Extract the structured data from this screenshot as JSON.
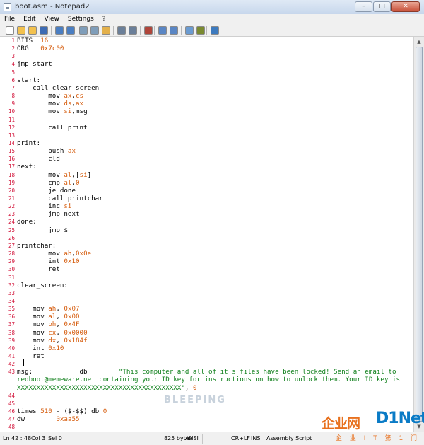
{
  "window": {
    "title": "boot.asm - Notepad2",
    "min_symbol": "–",
    "max_symbol": "□",
    "close_symbol": "✕"
  },
  "menu": [
    "File",
    "Edit",
    "View",
    "Settings",
    "?"
  ],
  "toolbar_icons": [
    "new-icon",
    "open-icon",
    "browse-icon",
    "save-icon",
    "undo-icon",
    "redo-icon",
    "cut-icon",
    "copy-icon",
    "paste-icon",
    "find-icon",
    "replace-icon",
    "wordwrap-icon",
    "zoom-in-icon",
    "zoom-out-icon",
    "scheme-icon",
    "settings-icon",
    "exit-icon"
  ],
  "lines": [
    {
      "n": "1",
      "t": [
        [
          "BITS  ",
          ""
        ],
        [
          "16",
          "num"
        ]
      ]
    },
    {
      "n": "2",
      "t": [
        [
          "ORG   ",
          ""
        ],
        [
          "0x7c00",
          "num"
        ]
      ]
    },
    {
      "n": "3",
      "t": []
    },
    {
      "n": "4",
      "t": [
        [
          "jmp start",
          ""
        ]
      ]
    },
    {
      "n": "5",
      "t": []
    },
    {
      "n": "6",
      "t": [
        [
          "start:",
          ""
        ]
      ]
    },
    {
      "n": "7",
      "t": [
        [
          "    call clear_screen",
          ""
        ]
      ]
    },
    {
      "n": "8",
      "t": [
        [
          "        mov ",
          ""
        ],
        [
          "ax",
          "reg"
        ],
        [
          ",",
          ""
        ],
        [
          "cs",
          "reg"
        ]
      ]
    },
    {
      "n": "9",
      "t": [
        [
          "        mov ",
          ""
        ],
        [
          "ds",
          "reg"
        ],
        [
          ",",
          ""
        ],
        [
          "ax",
          "reg"
        ]
      ]
    },
    {
      "n": "10",
      "t": [
        [
          "        mov ",
          ""
        ],
        [
          "si",
          "reg"
        ],
        [
          ",msg",
          ""
        ]
      ]
    },
    {
      "n": "11",
      "t": []
    },
    {
      "n": "12",
      "t": [
        [
          "        call print",
          ""
        ]
      ]
    },
    {
      "n": "13",
      "t": []
    },
    {
      "n": "14",
      "t": [
        [
          "print:",
          ""
        ]
      ]
    },
    {
      "n": "15",
      "t": [
        [
          "        push ",
          ""
        ],
        [
          "ax",
          "reg"
        ]
      ]
    },
    {
      "n": "16",
      "t": [
        [
          "        cld",
          ""
        ]
      ]
    },
    {
      "n": "17",
      "t": [
        [
          "next:",
          ""
        ]
      ]
    },
    {
      "n": "18",
      "t": [
        [
          "        mov ",
          ""
        ],
        [
          "al",
          "reg"
        ],
        [
          ",[",
          ""
        ],
        [
          "si",
          "reg"
        ],
        [
          "]",
          ""
        ]
      ]
    },
    {
      "n": "19",
      "t": [
        [
          "        cmp ",
          ""
        ],
        [
          "al",
          "reg"
        ],
        [
          ",",
          ""
        ],
        [
          "0",
          "num"
        ]
      ]
    },
    {
      "n": "20",
      "t": [
        [
          "        je done",
          ""
        ]
      ]
    },
    {
      "n": "21",
      "t": [
        [
          "        call printchar",
          ""
        ]
      ]
    },
    {
      "n": "22",
      "t": [
        [
          "        inc ",
          ""
        ],
        [
          "si",
          "reg"
        ]
      ]
    },
    {
      "n": "23",
      "t": [
        [
          "        jmp next",
          ""
        ]
      ]
    },
    {
      "n": "24",
      "t": [
        [
          "done:",
          ""
        ]
      ]
    },
    {
      "n": "25",
      "t": [
        [
          "        jmp $",
          ""
        ]
      ]
    },
    {
      "n": "26",
      "t": []
    },
    {
      "n": "27",
      "t": [
        [
          "printchar:",
          ""
        ]
      ]
    },
    {
      "n": "28",
      "t": [
        [
          "        mov ",
          ""
        ],
        [
          "ah",
          "reg"
        ],
        [
          ",",
          ""
        ],
        [
          "0x0e",
          "num"
        ]
      ]
    },
    {
      "n": "29",
      "t": [
        [
          "        int ",
          ""
        ],
        [
          "0x10",
          "num"
        ]
      ]
    },
    {
      "n": "30",
      "t": [
        [
          "        ret",
          ""
        ]
      ]
    },
    {
      "n": "31",
      "t": []
    },
    {
      "n": "32",
      "t": [
        [
          "clear_screen:",
          ""
        ]
      ]
    },
    {
      "n": "33",
      "t": []
    },
    {
      "n": "34",
      "t": []
    },
    {
      "n": "35",
      "t": [
        [
          "    mov ",
          ""
        ],
        [
          "ah",
          "reg"
        ],
        [
          ", ",
          ""
        ],
        [
          "0x07",
          "num"
        ]
      ]
    },
    {
      "n": "36",
      "t": [
        [
          "    mov ",
          ""
        ],
        [
          "al",
          "reg"
        ],
        [
          ", ",
          ""
        ],
        [
          "0x00",
          "num"
        ]
      ]
    },
    {
      "n": "37",
      "t": [
        [
          "    mov ",
          ""
        ],
        [
          "bh",
          "reg"
        ],
        [
          ", ",
          ""
        ],
        [
          "0x4F",
          "num"
        ]
      ]
    },
    {
      "n": "38",
      "t": [
        [
          "    mov ",
          ""
        ],
        [
          "cx",
          "reg"
        ],
        [
          ", ",
          ""
        ],
        [
          "0x0000",
          "num"
        ]
      ]
    },
    {
      "n": "39",
      "t": [
        [
          "    mov ",
          ""
        ],
        [
          "dx",
          "reg"
        ],
        [
          ", ",
          ""
        ],
        [
          "0x184f",
          "num"
        ]
      ]
    },
    {
      "n": "40",
      "t": [
        [
          "    int ",
          ""
        ],
        [
          "0x10",
          "num"
        ]
      ]
    },
    {
      "n": "41",
      "t": [
        [
          "    ret",
          ""
        ]
      ]
    },
    {
      "n": "42",
      "t": []
    },
    {
      "n": "43",
      "t": [
        [
          "msg:            db        ",
          ""
        ],
        [
          "\"This computer and all of it's files have been locked! Send an email to",
          "str"
        ]
      ]
    },
    {
      "n": "",
      "t": [
        [
          "redboot@memeware.net containing your ID key for instructions on how to unlock them. Your ID key is",
          "str"
        ]
      ]
    },
    {
      "n": "",
      "t": [
        [
          "XXXXXXXXXXXXXXXXXXXXXXXXXXXXXXXXXXXXXXXXXX\"",
          "str"
        ],
        [
          ", ",
          ""
        ],
        [
          "0",
          "num"
        ]
      ]
    },
    {
      "n": "44",
      "t": []
    },
    {
      "n": "45",
      "t": []
    },
    {
      "n": "46",
      "t": [
        [
          "times ",
          ""
        ],
        [
          "510",
          "num"
        ],
        [
          " - ($-$$) db ",
          ""
        ],
        [
          "0",
          "num"
        ]
      ]
    },
    {
      "n": "47",
      "t": [
        [
          "dw        ",
          ""
        ],
        [
          "0xaa55",
          "num"
        ]
      ]
    },
    {
      "n": "48",
      "t": []
    }
  ],
  "watermark": "BLEEPING",
  "status": {
    "position": "Ln 42 : 48",
    "col": "Col 3",
    "sel": "Sel 0",
    "size": "825 bytes",
    "encoding": "ANSI",
    "eol": "CR+LF",
    "mode": "INS",
    "scheme": "Assembly Script"
  },
  "logo": {
    "brand_a": "企业网",
    "brand_b": "D1Net",
    "tagline": "企 业 I T 第 1 门 户"
  },
  "colors": {
    "line_number": "#d2143a",
    "number": "#d65d0e",
    "string": "#10801c"
  }
}
